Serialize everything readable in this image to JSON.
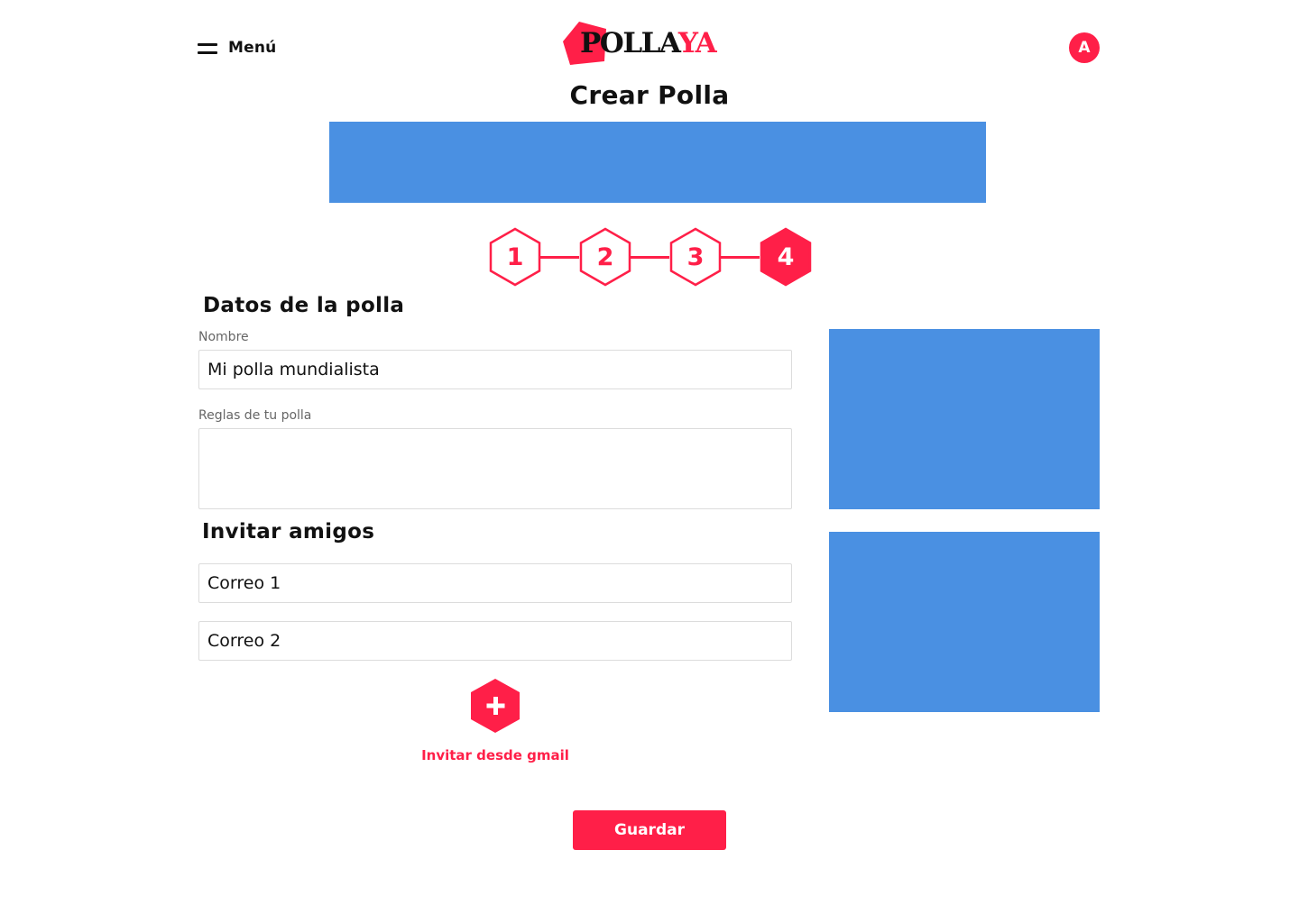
{
  "header": {
    "menu_label": "Menú",
    "logo_part1": "POLLA",
    "logo_part2": "YA",
    "avatar_initial": "A"
  },
  "page_title": "Crear Polla",
  "stepper": {
    "steps": [
      "1",
      "2",
      "3",
      "4"
    ],
    "active_step": "4"
  },
  "form": {
    "section_details": "Datos de la polla",
    "name_label": "Nombre",
    "name_value": "Mi polla mundialista",
    "rules_label": "Reglas de tu polla",
    "rules_value": "",
    "section_invite": "Invitar amigos",
    "email1_value": "Correo 1",
    "email2_value": "Correo 2",
    "gmail_link": "Invitar desde gmail",
    "save_label": "Guardar"
  },
  "colors": {
    "accent": "#ff1f48",
    "ad_placeholder": "#4a90e2",
    "text": "#111111",
    "input_border": "#dcdcdc"
  },
  "icons": {
    "menu": "hamburger-icon",
    "add": "plus-icon"
  }
}
